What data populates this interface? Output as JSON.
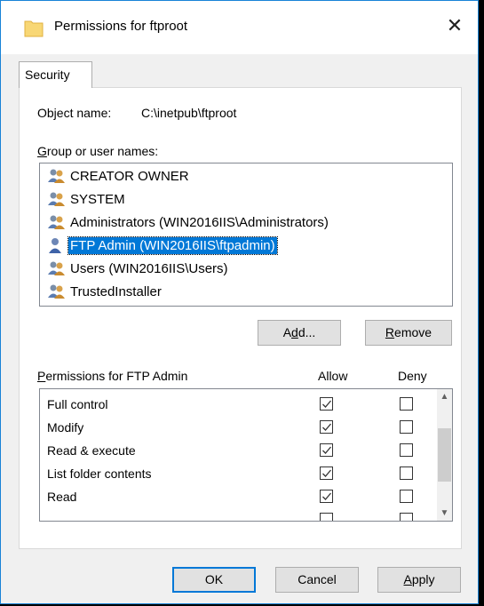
{
  "window": {
    "title": "Permissions for ftproot",
    "close_glyph": "✕"
  },
  "tabs": [
    {
      "label": "Security"
    }
  ],
  "object": {
    "label": "Object name:",
    "value": "C:\\inetpub\\ftproot"
  },
  "users": {
    "label_prefix": "G",
    "label_rest": "roup or user names:",
    "items": [
      {
        "name": "CREATOR OWNER",
        "icon": "group-icon"
      },
      {
        "name": "SYSTEM",
        "icon": "group-icon"
      },
      {
        "name": "Administrators (WIN2016IIS\\Administrators)",
        "icon": "group-icon"
      },
      {
        "name": "FTP Admin (WIN2016IIS\\ftpadmin)",
        "icon": "user-icon",
        "selected": true
      },
      {
        "name": "Users (WIN2016IIS\\Users)",
        "icon": "group-icon"
      },
      {
        "name": "TrustedInstaller",
        "icon": "group-icon"
      }
    ]
  },
  "buttons": {
    "add_pre": "A",
    "add_mn": "d",
    "add_post": "d...",
    "remove_mn": "R",
    "remove_post": "emove",
    "ok": "OK",
    "cancel": "Cancel",
    "apply_mn": "A",
    "apply_post": "pply"
  },
  "permissions": {
    "label_mn": "P",
    "label_rest": "ermissions for FTP Admin",
    "allow_header": "Allow",
    "deny_header": "Deny",
    "rows": [
      {
        "name": "Full control",
        "allow": true,
        "deny": false
      },
      {
        "name": "Modify",
        "allow": true,
        "deny": false
      },
      {
        "name": "Read & execute",
        "allow": true,
        "deny": false
      },
      {
        "name": "List folder contents",
        "allow": true,
        "deny": false
      },
      {
        "name": "Read",
        "allow": true,
        "deny": false
      }
    ]
  },
  "colors": {
    "selection": "#0078d7",
    "accent_border": "#1883d7"
  }
}
